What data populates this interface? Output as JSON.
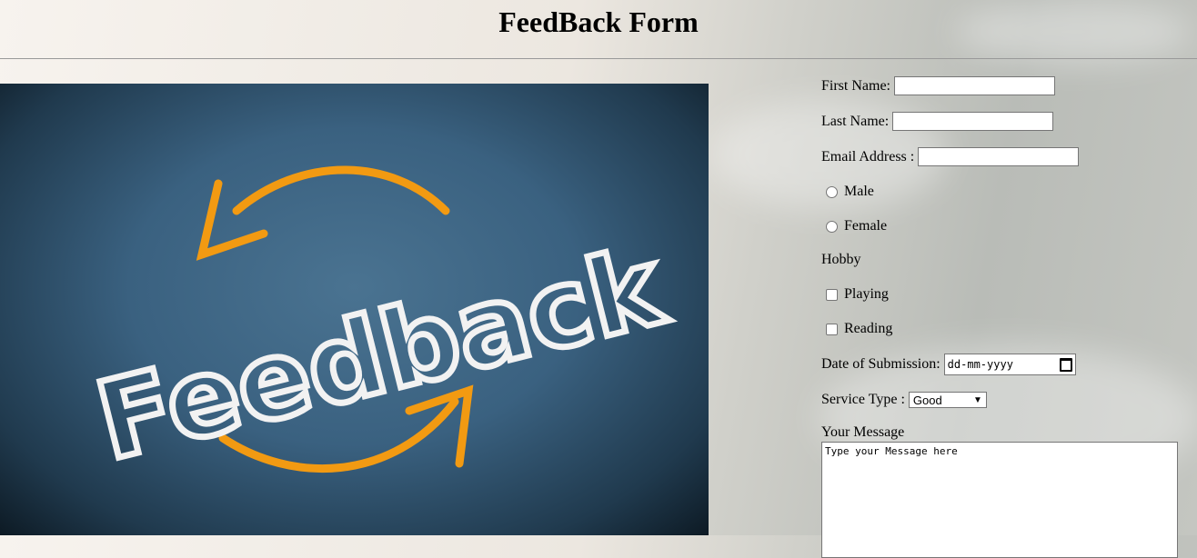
{
  "page": {
    "title": "FeedBack Form"
  },
  "image": {
    "alt_text": "Feedback"
  },
  "form": {
    "first_name_label": "First Name:",
    "first_name_value": "",
    "last_name_label": "Last Name:",
    "last_name_value": "",
    "email_label": "Email Address :",
    "email_value": "",
    "gender_options": [
      "Male",
      "Female"
    ],
    "hobby_label": "Hobby",
    "hobbies": [
      "Playing",
      "Reading"
    ],
    "date_label": "Date of Submission:",
    "date_placeholder": "dd-mm-yyyy",
    "service_label": "Service Type :",
    "service_selected": "Good",
    "message_label": "Your Message",
    "message_value": "Type your Message here"
  }
}
